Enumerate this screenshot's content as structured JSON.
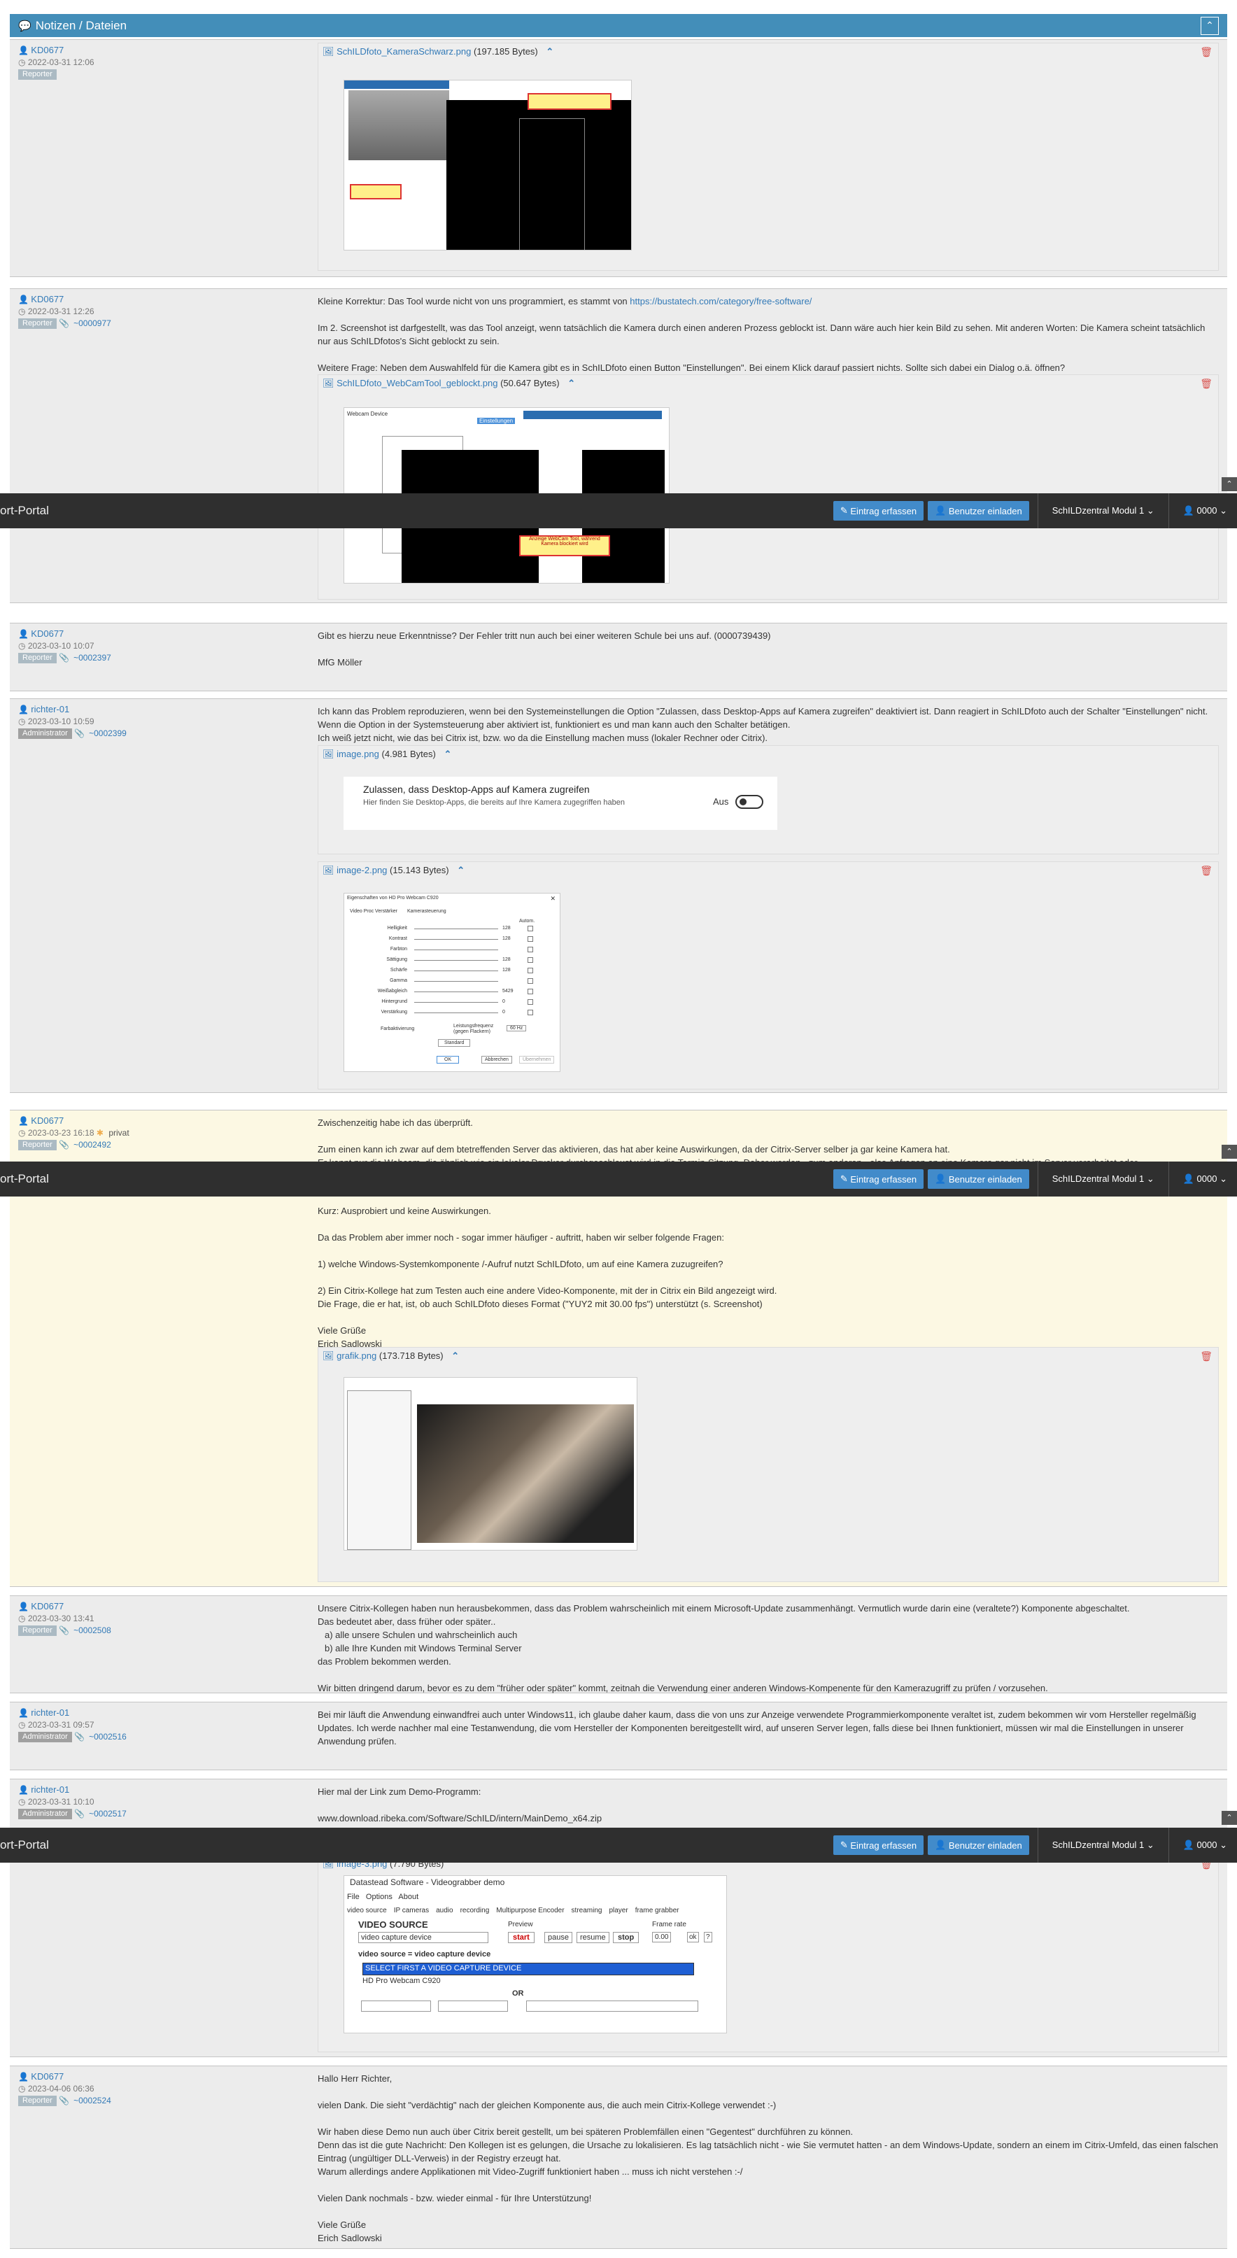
{
  "section": {
    "title": "Notizen / Dateien"
  },
  "navbar": {
    "brand": "ort-Portal",
    "btn_entry": "Eintrag erfassen",
    "btn_invite": "Benutzer einladen",
    "module": "SchILDzentral Modul 1",
    "user": "0000"
  },
  "notes": [
    {
      "author": "KD0677",
      "date": "2022-03-31 12:06",
      "role": "Reporter",
      "ref": "",
      "attachments": [
        {
          "name": "SchILDfoto_KameraSchwarz.png",
          "size": "(197.185 Bytes)"
        }
      ]
    },
    {
      "author": "KD0677",
      "date": "2022-03-31 12:26",
      "role": "Reporter",
      "ref": "~0000977",
      "text": [
        "Kleine Korrektur: Das Tool wurde nicht von uns programmiert, es stammt von",
        "https://bustatech.com/category/free-software/",
        "Im 2. Screenshot ist darfgestellt, was das Tool anzeigt, wenn tatsächlich die Kamera durch einen anderen Prozess geblockt ist. Dann wäre auch hier kein Bild zu sehen. Mit anderen Worten: Die Kamera scheint tatsächlich nur aus SchILDfotos's Sicht geblockt zu sein.",
        "Weitere Frage: Neben dem Auswahlfeld für die Kamera gibt es in SchILDfoto einen Button \"Einstellungen\". Bei einem Klick darauf passiert nichts. Sollte sich dabei ein Dialog o.ä. öffnen?"
      ],
      "attachments": [
        {
          "name": "SchILDfoto_WebCamTool_geblockt.png",
          "size": "(50.647 Bytes)"
        }
      ],
      "mock": {
        "label1": "Webcam Device",
        "label2": "Einstellungen",
        "warn": "Anzeige WebCam Tool, während Kamera blockiert wird"
      }
    },
    {
      "author": "KD0677",
      "date": "2023-03-10 10:07",
      "role": "Reporter",
      "ref": "~0002397",
      "text": [
        "Gibt es hierzu neue Erkenntnisse? Der Fehler tritt nun auch bei einer weiteren Schule bei uns auf. (0000739439)",
        "MfG Möller"
      ]
    },
    {
      "author": "richter-01",
      "date": "2023-03-10 10:59",
      "role": "Administrator",
      "ref": "~0002399",
      "text": [
        "Ich kann das Problem reproduzieren, wenn bei den Systemeinstellungen die Option \"Zulassen, dass Desktop-Apps auf Kamera zugreifen\" deaktiviert ist. Dann reagiert in SchILDfoto auch der Schalter \"Einstellungen\" nicht. Wenn die Option in der Systemsteuerung aber aktiviert ist, funktioniert es und man kann auch den Schalter betätigen.",
        "Ich weiß jetzt nicht, wie das bei Citrix ist, bzw. wo da die Einstellung machen muss (lokaler Rechner oder Citrix)."
      ],
      "attachments": [
        {
          "name": "image.png",
          "size": "(4.981 Bytes)"
        },
        {
          "name": "image-2.png",
          "size": "(15.143 Bytes)"
        }
      ],
      "setting": {
        "title": "Zulassen, dass Desktop-Apps auf Kamera zugreifen",
        "desc": "Hier finden Sie Desktop-Apps, die bereits auf Ihre Kamera zugegriffen haben",
        "state": "Aus"
      },
      "dialog": {
        "title": "Eigenschaften von HD Pro Webcam C920",
        "tab1": "Video Proc Verstärker",
        "tab2": "Kamerasteuerung",
        "auto": "Autom.",
        "rows": [
          {
            "label": "Helligkeit",
            "value": "128"
          },
          {
            "label": "Kontrast",
            "value": "128"
          },
          {
            "label": "Farbton",
            "value": ""
          },
          {
            "label": "Sättigung",
            "value": "128"
          },
          {
            "label": "Schärfe",
            "value": "128"
          },
          {
            "label": "Gamma",
            "value": ""
          },
          {
            "label": "Weißabgleich",
            "value": "5429"
          },
          {
            "label": "Hintergrund",
            "value": "0"
          },
          {
            "label": "Verstärkung",
            "value": "0"
          }
        ],
        "farb": "Farbaktivierung",
        "freq_label": "Leistungsfrequenz (gegen Flackern)",
        "freq": "60 Hz",
        "std": "Standard",
        "ok": "OK",
        "cancel": "Abbrechen",
        "apply": "Übernehmen"
      }
    },
    {
      "author": "KD0677",
      "date": "2023-03-23 16:18",
      "private": "privat",
      "role": "Reporter",
      "ref": "~0002492",
      "text_top": [
        "Zwischenzeitig habe ich das überprüft.",
        "Zum einen kann ich zwar auf dem btetreffenden Server das aktivieren, das hat aber keine Auswirkungen, da der Citrix-Server selber ja gar keine Kamera hat.",
        "Er kennt nur die Webcam, die ähnlich wie ein lokaler Drucker durchgeschleust wird in die Termin-Sitzung. Daher werden - zum anderen - also Anfragen an eine Kamera gar nicht im Server verarbeitet oder"
      ],
      "text": [
        "Kurz: Ausprobiert und keine Auswirkungen.",
        "Da das Problem aber immer noch - sogar immer häufiger - auftritt, haben wir selber folgende Fragen:",
        "1) welche Windows-Systemkomponente /-Aufruf nutzt SchILDfoto, um auf eine Kamera zuzugreifen?",
        "2) Ein Citrix-Kollege hat zum Testen auch eine andere Video-Komponente, mit der in Citrix ein Bild angezeigt wird.",
        "Die Frage, die er hat, ist, ob auch SchILDfoto dieses Format (\"YUY2 mit 30.00 fps\") unterstützt (s. Screenshot)",
        "Viele Grüße",
        "Erich Sadlowski"
      ],
      "attachments": [
        {
          "name": "grafik.png",
          "size": "(173.718 Bytes)"
        }
      ]
    },
    {
      "author": "KD0677",
      "date": "2023-03-30 13:41",
      "role": "Reporter",
      "ref": "~0002508",
      "text": [
        "Unsere Citrix-Kollegen haben nun herausbekommen, dass das Problem wahrscheinlich mit einem Microsoft-Update zusammenhängt. Vermutlich wurde darin eine (veraltete?) Komponente abgeschaltet.",
        "Das bedeutet aber, dass früher oder später..",
        "a) alle unsere Schulen und wahrscheinlich auch",
        "b) alle Ihre Kunden mit Windows Terminal Server",
        "das Problem bekommen werden.",
        "Wir bitten dringend darum, bevor es zu dem \"früher oder später\" kommt, zeitnah die Verwendung einer anderen Windows-Kompenente für den Kamerazugriff zu prüfen / vorzusehen."
      ]
    },
    {
      "author": "richter-01",
      "date": "2023-03-31 09:57",
      "role": "Administrator",
      "ref": "~0002516",
      "text": [
        "Bei mir läuft die Anwendung einwandfrei auch unter Windows11, ich glaube daher kaum, dass die von uns zur Anzeige verwendete Programmierkomponente veraltet ist, zudem bekommen wir vom Hersteller regelmäßig Updates. Ich werde nachher mal eine Testanwendung, die vom Hersteller der Komponenten bereitgestellt wird, auf unseren Server legen, falls diese bei Ihnen funktioniert, müssen wir mal die Einstellungen in unserer Anwendung prüfen."
      ]
    },
    {
      "author": "richter-01",
      "date": "2023-03-31 10:10",
      "role": "Administrator",
      "ref": "~0002517",
      "text": [
        "Hier mal der Link zum Demo-Programm:",
        "www.download.ribeka.com/Software/SchILD/intern/MainDemo_x64.zip"
      ],
      "attachments": [
        {
          "name": "image-3.png",
          "size": "(7.790 Bytes)"
        }
      ],
      "demo": {
        "app": "Datastead Software - Videograbber demo",
        "menu": [
          "File",
          "Options",
          "About"
        ],
        "tabs": [
          "video source",
          "IP cameras",
          "audio",
          "recording",
          "Multipurpose Encoder",
          "streaming",
          "player",
          "frame grabber"
        ],
        "vs_title": "VIDEO SOURCE",
        "preview": "Preview",
        "framerate": "Frame rate",
        "source_value": "video capture device",
        "b_start": "start",
        "b_pause": "pause",
        "b_resume": "resume",
        "b_stop": "stop",
        "fr_value": "0.00",
        "ok": "ok",
        "q": "?",
        "vs_eq": "video source = video capture device",
        "sel": "SELECT FIRST A VIDEO CAPTURE DEVICE",
        "opt": "HD Pro Webcam C920",
        "or": "OR"
      }
    },
    {
      "author": "KD0677",
      "date": "2023-04-06 06:36",
      "role": "Reporter",
      "ref": "~0002524",
      "text": [
        "Hallo Herr Richter,",
        "vielen Dank. Die sieht \"verdächtig\" nach der gleichen Komponente aus, die auch mein Citrix-Kollege verwendet :-)",
        "Wir haben diese Demo nun auch über Citrix bereit gestellt, um bei späteren Problemfällen einen \"Gegentest\" durchführen zu können.",
        "Denn das ist die gute Nachricht: Den Kollegen ist es gelungen, die Ursache zu lokalisieren. Es lag tatsächlich nicht - wie Sie vermutet hatten - an dem Windows-Update, sondern an einem im Citrix-Umfeld, das einen falschen Eintrag (ungültiger DLL-Verweis) in der Registry erzeugt hat.",
        "Warum allerdings andere Applikationen mit Video-Zugriff funktioniert haben ... muss ich nicht verstehen :-/",
        "Vielen Dank nochmals - bzw. wieder einmal - für Ihre Unterstützung!",
        "Viele Grüße",
        "Erich Sadlowski"
      ]
    }
  ]
}
